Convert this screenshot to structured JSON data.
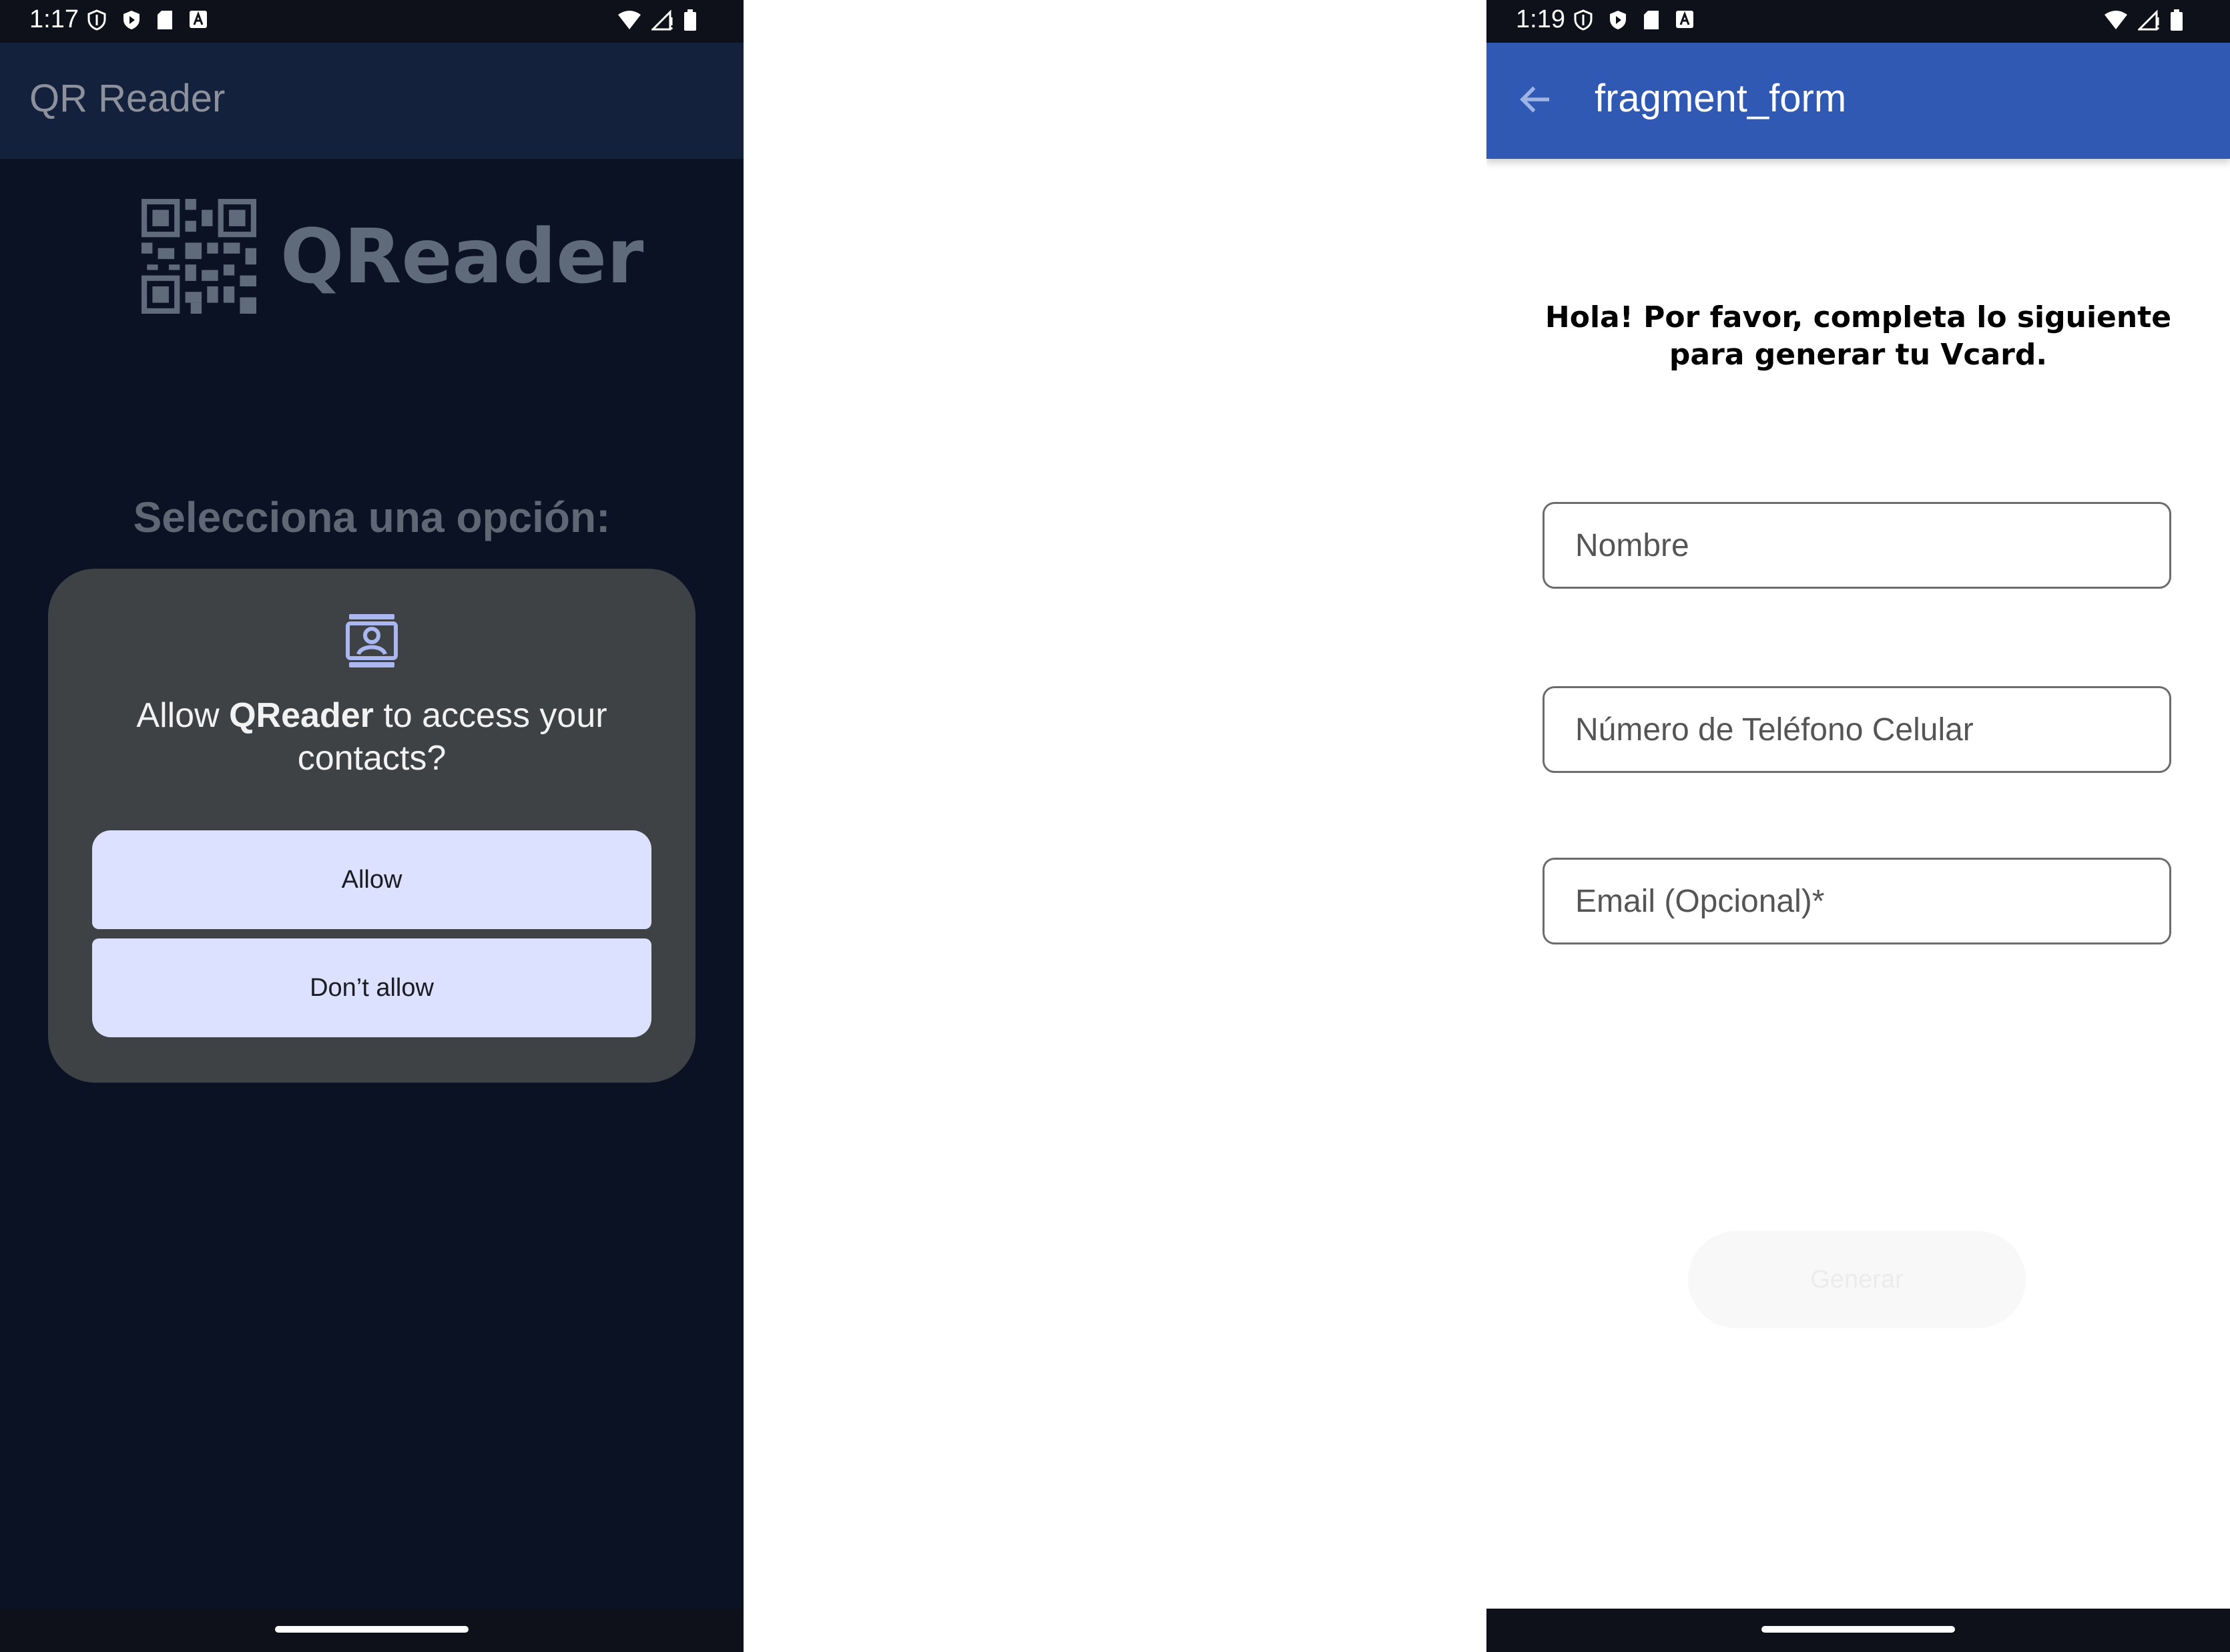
{
  "left_screen": {
    "status": {
      "time": "1:17"
    },
    "toolbar": {
      "title": "QR Reader"
    },
    "brand": {
      "name": "QReader"
    },
    "prompt": "Selecciona una opción:",
    "permission_dialog": {
      "text_prefix": "Allow ",
      "app_name": "QReader",
      "text_suffix": " to access your contacts?",
      "allow_label": "Allow",
      "deny_label": "Don’t allow",
      "icon": "contacts-icon"
    }
  },
  "right_screen": {
    "status": {
      "time": "1:19"
    },
    "toolbar": {
      "title": "fragment_form",
      "back_icon": "arrow-back-icon"
    },
    "heading": "Hola! Por favor, completa lo siguiente para generar tu Vcard.",
    "form": {
      "name_placeholder": "Nombre",
      "phone_placeholder": "Número de Teléfono Celular",
      "email_placeholder": "Email (Opcional)*",
      "submit_label": "Generar"
    }
  },
  "colors": {
    "left_bg": "#0a1223",
    "left_toolbar": "#13213d",
    "dialog_bg": "#3f4245",
    "dialog_button": "#dbe1ff",
    "right_toolbar": "#2f59b3"
  }
}
